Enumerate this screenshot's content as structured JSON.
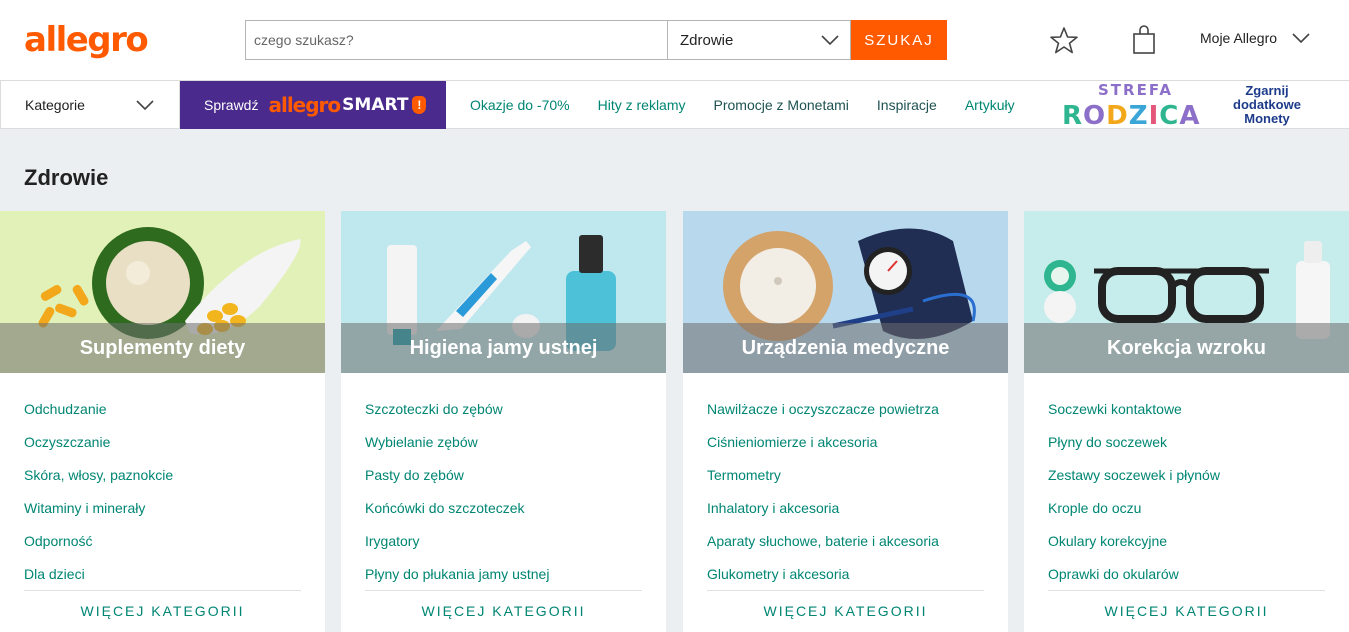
{
  "header": {
    "logo": "allegro",
    "search": {
      "placeholder": "czego szukasz?",
      "category": "Zdrowie",
      "button": "SZUKAJ"
    },
    "account": "Moje Allegro"
  },
  "nav": {
    "categories": "Kategorie",
    "smart_prefix": "Sprawdź",
    "smart_logo": "allegro",
    "smart_word": "SMART",
    "smart_badge": "!",
    "links": [
      {
        "label": "Okazje do -70%"
      },
      {
        "label": "Hity z reklamy"
      },
      {
        "label": "Promocje z Monetami"
      },
      {
        "label": "Inspiracje"
      },
      {
        "label": "Artykuły"
      }
    ],
    "strefa_top": "STREFA",
    "strefa_bottom": "RODZICA",
    "zgarnij": [
      "Zgarnij",
      "dodatkowe",
      "Monety"
    ]
  },
  "page_title": "Zdrowie",
  "cards": [
    {
      "title": "Suplementy diety",
      "items": [
        "Odchudzanie",
        "Oczyszczanie",
        "Skóra, włosy, paznokcie",
        "Witaminy i minerały",
        "Odporność",
        "Dla dzieci"
      ],
      "more": "WIĘCEJ KATEGORII"
    },
    {
      "title": "Higiena jamy ustnej",
      "items": [
        "Szczoteczki do zębów",
        "Wybielanie zębów",
        "Pasty do zębów",
        "Końcówki do szczoteczek",
        "Irygatory",
        "Płyny do płukania jamy ustnej"
      ],
      "more": "WIĘCEJ KATEGORII"
    },
    {
      "title": "Urządzenia medyczne",
      "items": [
        "Nawilżacze i oczyszczacze powietrza",
        "Ciśnieniomierze i akcesoria",
        "Termometry",
        "Inhalatory i akcesoria",
        "Aparaty słuchowe, baterie i akcesoria",
        "Glukometry i akcesoria"
      ],
      "more": "WIĘCEJ KATEGORII"
    },
    {
      "title": "Korekcja wzroku",
      "items": [
        "Soczewki kontaktowe",
        "Płyny do soczewek",
        "Zestawy soczewek i płynów",
        "Krople do oczu",
        "Okulary korekcyjne",
        "Oprawki do okularów"
      ],
      "more": "WIĘCEJ KATEGORII"
    }
  ],
  "colors": {
    "brand": "#ff5a00",
    "link": "#008673",
    "smart_bg": "#4a2a8c"
  }
}
